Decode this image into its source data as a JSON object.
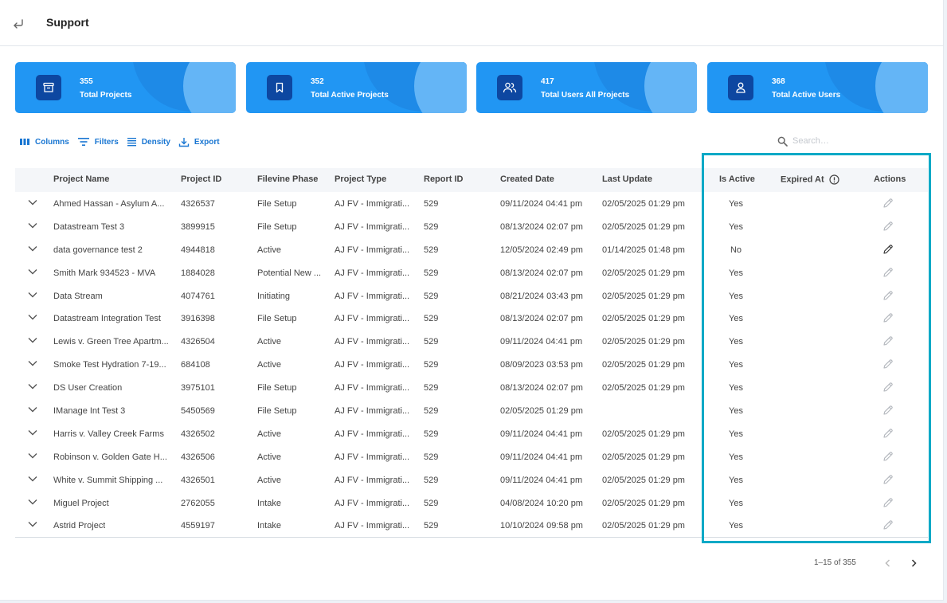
{
  "header": {
    "title": "Support",
    "back_icon": "return-arrow-icon"
  },
  "cards": [
    {
      "value": "355",
      "label": "Total Projects",
      "icon": "archive-box-icon"
    },
    {
      "value": "352",
      "label": "Total Active Projects",
      "icon": "bookmark-icon"
    },
    {
      "value": "417",
      "label": "Total Users All Projects",
      "icon": "users-icon"
    },
    {
      "value": "368",
      "label": "Total Active Users",
      "icon": "user-icon"
    }
  ],
  "toolbar": {
    "columns_label": "Columns",
    "filters_label": "Filters",
    "density_label": "Density",
    "export_label": "Export"
  },
  "search": {
    "placeholder": "Search…",
    "value": ""
  },
  "colors": {
    "accent": "#2196f3",
    "highlight": "#00a9c6",
    "card_icon_bg": "#0d47a1"
  },
  "table": {
    "columns": {
      "project_name": "Project Name",
      "project_id": "Project ID",
      "filevine_phase": "Filevine Phase",
      "project_type": "Project Type",
      "report_id": "Report ID",
      "created_date": "Created Date",
      "last_update": "Last Update",
      "is_active": "Is Active",
      "expired_at": "Expired At",
      "actions": "Actions"
    },
    "rows": [
      {
        "name": "Ahmed Hassan - Asylum A...",
        "id": "4326537",
        "phase": "File Setup",
        "type": "AJ FV - Immigrati...",
        "report": "529",
        "created": "09/11/2024 04:41 pm",
        "updated": "02/05/2025 01:29 pm",
        "active": "Yes",
        "expired": ""
      },
      {
        "name": "Datastream Test 3",
        "id": "3899915",
        "phase": "File Setup",
        "type": "AJ FV - Immigrati...",
        "report": "529",
        "created": "08/13/2024 02:07 pm",
        "updated": "02/05/2025 01:29 pm",
        "active": "Yes",
        "expired": ""
      },
      {
        "name": "data governance test 2",
        "id": "4944818",
        "phase": "Active",
        "type": "AJ FV - Immigrati...",
        "report": "529",
        "created": "12/05/2024 02:49 pm",
        "updated": "01/14/2025 01:48 pm",
        "active": "No",
        "expired": ""
      },
      {
        "name": "Smith Mark 934523 - MVA",
        "id": "1884028",
        "phase": "Potential New ...",
        "type": "AJ FV - Immigrati...",
        "report": "529",
        "created": "08/13/2024 02:07 pm",
        "updated": "02/05/2025 01:29 pm",
        "active": "Yes",
        "expired": ""
      },
      {
        "name": "Data Stream",
        "id": "4074761",
        "phase": "Initiating",
        "type": "AJ FV - Immigrati...",
        "report": "529",
        "created": "08/21/2024 03:43 pm",
        "updated": "02/05/2025 01:29 pm",
        "active": "Yes",
        "expired": ""
      },
      {
        "name": "Datastream Integration Test",
        "id": "3916398",
        "phase": "File Setup",
        "type": "AJ FV - Immigrati...",
        "report": "529",
        "created": "08/13/2024 02:07 pm",
        "updated": "02/05/2025 01:29 pm",
        "active": "Yes",
        "expired": ""
      },
      {
        "name": "Lewis v. Green Tree Apartm...",
        "id": "4326504",
        "phase": "Active",
        "type": "AJ FV - Immigrati...",
        "report": "529",
        "created": "09/11/2024 04:41 pm",
        "updated": "02/05/2025 01:29 pm",
        "active": "Yes",
        "expired": ""
      },
      {
        "name": "Smoke Test Hydration 7-19...",
        "id": "684108",
        "phase": "Active",
        "type": "AJ FV - Immigrati...",
        "report": "529",
        "created": "08/09/2023 03:53 pm",
        "updated": "02/05/2025 01:29 pm",
        "active": "Yes",
        "expired": ""
      },
      {
        "name": "DS User Creation",
        "id": "3975101",
        "phase": "File Setup",
        "type": "AJ FV - Immigrati...",
        "report": "529",
        "created": "08/13/2024 02:07 pm",
        "updated": "02/05/2025 01:29 pm",
        "active": "Yes",
        "expired": ""
      },
      {
        "name": "IManage Int Test 3",
        "id": "5450569",
        "phase": "File Setup",
        "type": "AJ FV - Immigrati...",
        "report": "529",
        "created": "02/05/2025 01:29 pm",
        "updated": "",
        "active": "Yes",
        "expired": ""
      },
      {
        "name": "Harris v. Valley Creek Farms",
        "id": "4326502",
        "phase": "Active",
        "type": "AJ FV - Immigrati...",
        "report": "529",
        "created": "09/11/2024 04:41 pm",
        "updated": "02/05/2025 01:29 pm",
        "active": "Yes",
        "expired": ""
      },
      {
        "name": "Robinson v. Golden Gate H...",
        "id": "4326506",
        "phase": "Active",
        "type": "AJ FV - Immigrati...",
        "report": "529",
        "created": "09/11/2024 04:41 pm",
        "updated": "02/05/2025 01:29 pm",
        "active": "Yes",
        "expired": ""
      },
      {
        "name": "White v. Summit Shipping ...",
        "id": "4326501",
        "phase": "Active",
        "type": "AJ FV - Immigrati...",
        "report": "529",
        "created": "09/11/2024 04:41 pm",
        "updated": "02/05/2025 01:29 pm",
        "active": "Yes",
        "expired": ""
      },
      {
        "name": "Miguel Project",
        "id": "2762055",
        "phase": "Intake",
        "type": "AJ FV - Immigrati...",
        "report": "529",
        "created": "04/08/2024 10:20 pm",
        "updated": "02/05/2025 01:29 pm",
        "active": "Yes",
        "expired": ""
      },
      {
        "name": "Astrid Project",
        "id": "4559197",
        "phase": "Intake",
        "type": "AJ FV - Immigrati...",
        "report": "529",
        "created": "10/10/2024 09:58 pm",
        "updated": "02/05/2025 01:29 pm",
        "active": "Yes",
        "expired": ""
      }
    ]
  },
  "pagination": {
    "range_text": "1–15 of 355"
  }
}
